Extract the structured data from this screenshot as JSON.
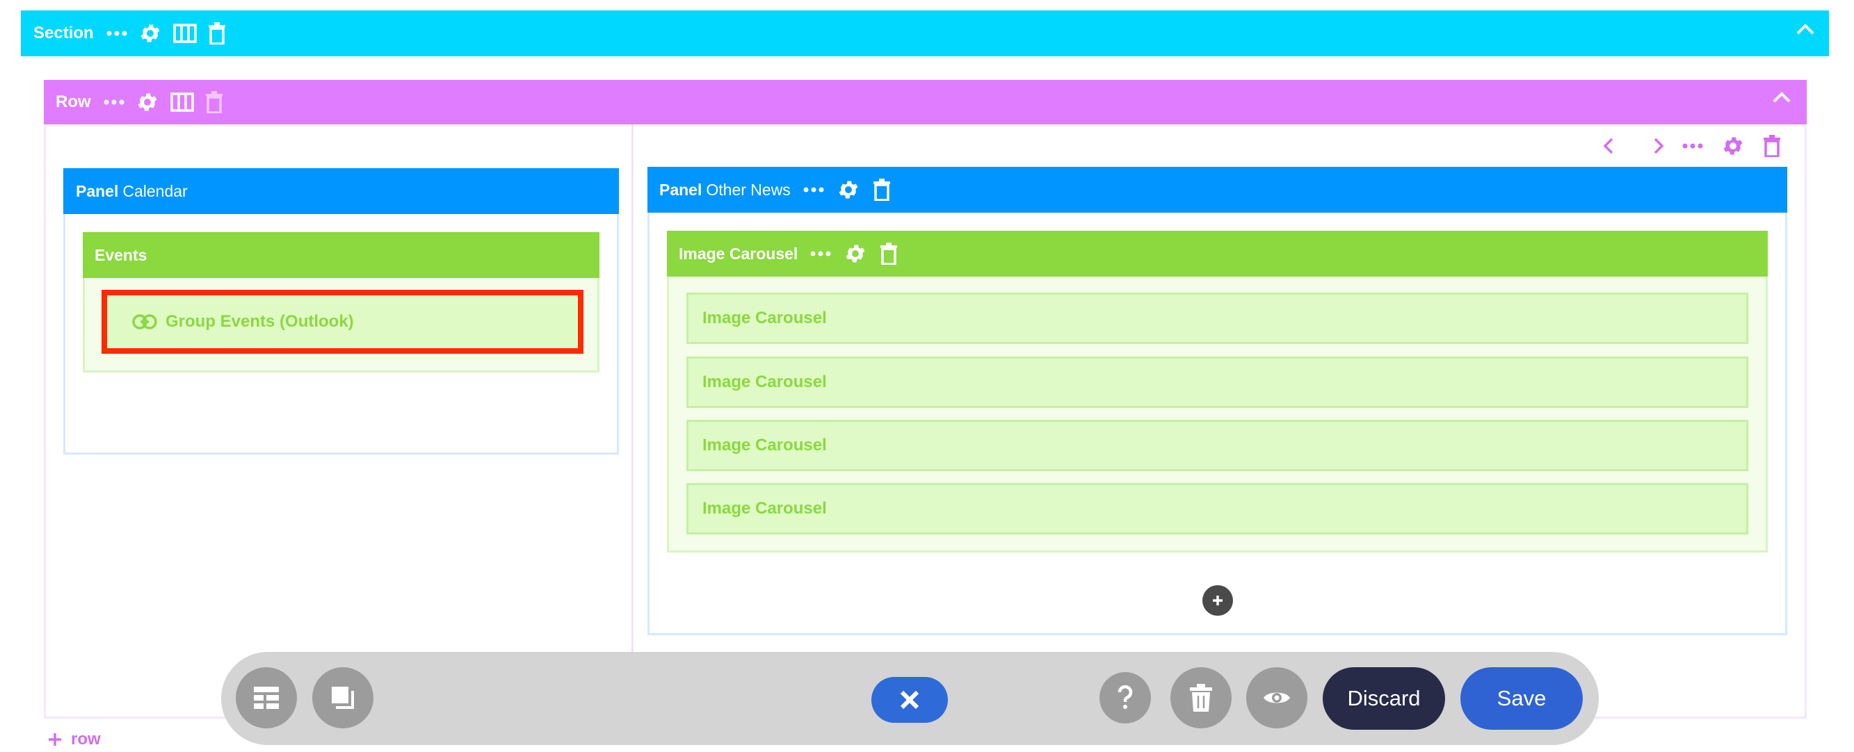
{
  "section": {
    "title": "Section"
  },
  "row": {
    "title": "Row"
  },
  "panel_left": {
    "prefix": "Panel",
    "name": "Calendar"
  },
  "events": {
    "title": "Events",
    "item_label": "Group Events (Outlook)"
  },
  "panel_right": {
    "prefix": "Panel",
    "name": "Other News"
  },
  "carousel": {
    "title": "Image Carousel",
    "items": [
      "Image Carousel",
      "Image Carousel",
      "Image Carousel",
      "Image Carousel"
    ]
  },
  "toolbar": {
    "discard_label": "Discard",
    "save_label": "Save"
  },
  "add_row": {
    "label": "row"
  },
  "colors": {
    "section": "#00d8ff",
    "row": "#e07cff",
    "panel": "#0095ff",
    "block": "#8bd83f",
    "highlight": "#ff2a00",
    "save": "#2f63d3",
    "discard": "#272b48"
  }
}
